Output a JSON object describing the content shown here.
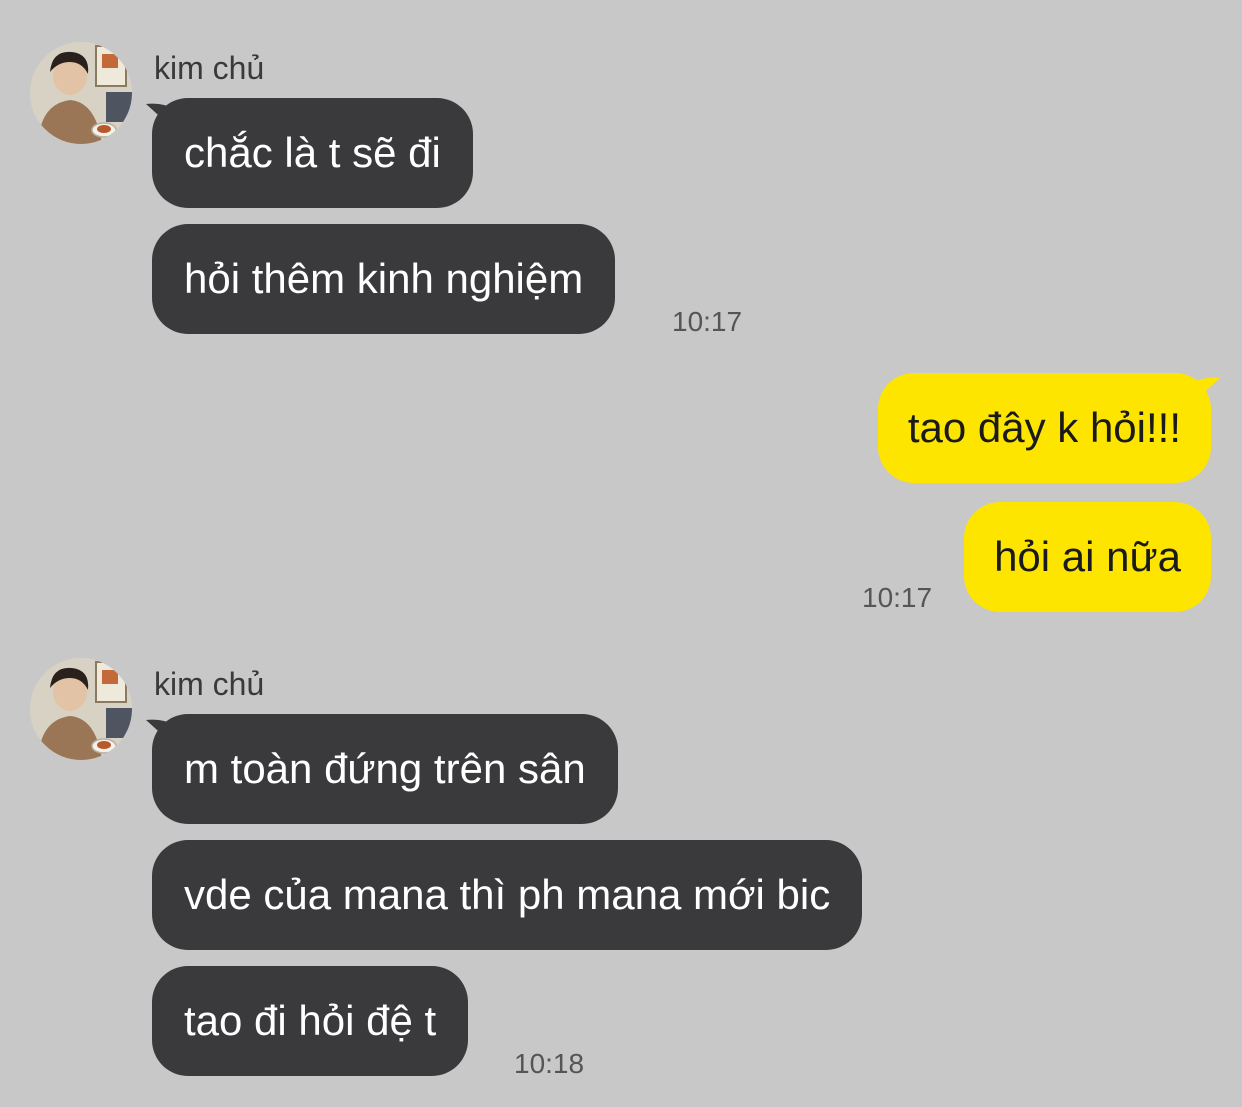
{
  "colors": {
    "background": "#c8c8c8",
    "incoming_bubble": "#3a3a3c",
    "outgoing_bubble": "#fee500"
  },
  "groups": [
    {
      "sender": "kim chủ",
      "avatar_icon": "profile-photo-icon",
      "messages": [
        "chắc là t sẽ đi",
        "hỏi thêm kinh nghiệm"
      ],
      "time": "10:17"
    },
    {
      "sender": "",
      "messages": [
        "tao đây k hỏi!!!",
        "hỏi ai nữa"
      ],
      "time": "10:17"
    },
    {
      "sender": "kim chủ",
      "avatar_icon": "profile-photo-icon",
      "messages": [
        "m toàn đứng trên sân",
        "vde của mana thì ph mana mới bic",
        "tao đi hỏi đệ t"
      ],
      "time": "10:18"
    }
  ]
}
